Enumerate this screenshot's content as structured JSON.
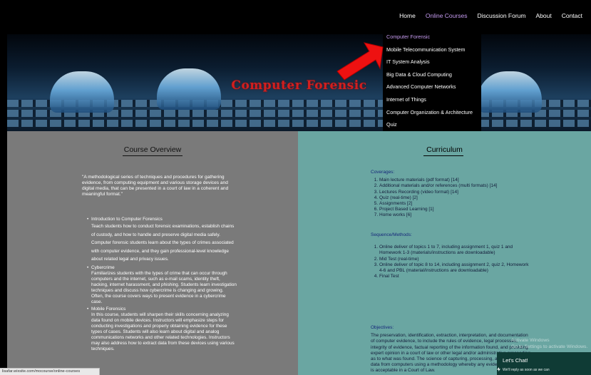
{
  "nav": {
    "items": [
      "Home",
      "Online Courses",
      "Discussion Forum",
      "About",
      "Contact"
    ],
    "active_color": "#c59bf0"
  },
  "banner": {
    "title": "Computer Forensic"
  },
  "dropdown": {
    "items": [
      "Computer Forensic",
      "Mobile Telecommunication System",
      "IT System Analysis",
      "Big Data & Cloud Computing",
      "Advanced Computer Networks",
      "Internet of Things",
      "Computer Organization & Architecture",
      "Quiz"
    ]
  },
  "overview": {
    "heading": "Course Overview",
    "quote": "\"A methodological series of techniques and procedures for gathering evidence, from computing equipment and various storage devices and digital media, that can be presented in a court of law in a coherent and meaningful format.\"",
    "items": [
      {
        "title": "Introduction to Computer Forensics",
        "desc": "Teach students how to conduct forensic examinations, establish chains of custody, and how to handle and preserve digital media safely. Computer forensic students learn about the types of crimes associated with computer evidence, and they gain professional-level knowledge about related legal and privacy issues."
      },
      {
        "title": "Cybercrime",
        "desc": "Familiarizes students with the types of crime that can occur through computers and the internet, such as e-mail scams, identity theft, hacking, internet harassment, and phishing. Students learn investigation techniques and discuss how cybercrime is changing and growing. Often, the course covers ways to present evidence in a cybercrime case."
      },
      {
        "title": "Mobile Forensics",
        "desc": "In this course, students will sharpen their skills concerning analyzing data found on mobile devices. Instructors will emphasize steps for conducting investigations and properly obtaining evidence for these types of cases. Students will also learn about digital and analog communications networks and other related technologies. Instructors may also address how to extract data from these devices using various techniques."
      }
    ]
  },
  "curriculum": {
    "heading": "Curriculum",
    "coverages_label": "Coverages:",
    "coverages": [
      "Main lecture materials (pdf format) [14]",
      "Additional materials and/or references (multi formats) [14]",
      "Lectures Recording (video format) [14]",
      "Quiz (real-time) [2]",
      "Assignments [2]",
      "Project Based Learning [1]",
      "Home works [6]"
    ],
    "sequence_label": "Sequence/Methods:",
    "sequence": [
      "Online deliver of topics 1 to 7, including assignment 1, quiz 1 and Homework 1-3 (materials/instructions are downloadable)",
      "Mid Test (real-time)",
      "Online deliver of topic 8 to 14, including assignment 2, quiz 2, Homework 4-6 and PBL (material/instructions are downloadable)",
      "Final Test"
    ],
    "objectives_label": "Objectives:",
    "objectives": "The preservation, identification, extraction, interpretation, and documentation of computer evidence, to include the rules of evidence, legal processes, integrity of evidence, factual reporting of the information found, and providing expert opinion in a court of law or other legal and/or administrative proceeding as to what was found. The science of capturing, processing, and investigating data from computers using a methodology whereby any evidence discovered is acceptable in a Court of Law."
  },
  "chat": {
    "title": "Let's Chat!",
    "subtitle": "We'll reply as soon as we can"
  },
  "watermark": {
    "line1": "Activate Windows",
    "line2": "Go to Settings to activate Windows."
  },
  "status": {
    "url": "lisafar.wixsite.com/mocourse/online-courses"
  }
}
